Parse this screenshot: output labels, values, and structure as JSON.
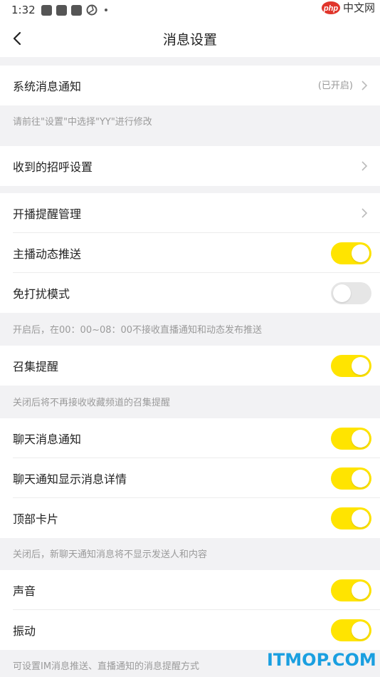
{
  "status_bar": {
    "time": "1:32"
  },
  "watermark": {
    "php": "php",
    "zhongwen": "中文网",
    "bottom": "ITMOP.COM"
  },
  "header": {
    "title": "消息设置"
  },
  "rows": {
    "system_notify": {
      "label": "系统消息通知",
      "status": "(已开启)"
    },
    "greeting": {
      "label": "收到的招呼设置"
    },
    "live_remind": {
      "label": "开播提醒管理"
    },
    "anchor_push": {
      "label": "主播动态推送",
      "on": true
    },
    "dnd_mode": {
      "label": "免打扰模式",
      "on": false
    },
    "gather_remind": {
      "label": "召集提醒",
      "on": true
    },
    "chat_notify": {
      "label": "聊天消息通知",
      "on": true
    },
    "chat_detail": {
      "label": "聊天通知显示消息详情",
      "on": true
    },
    "top_card": {
      "label": "顶部卡片",
      "on": true
    },
    "sound": {
      "label": "声音",
      "on": true
    },
    "vibrate": {
      "label": "振动",
      "on": true
    }
  },
  "notes": {
    "system": "请前往\"设置\"中选择\"YY\"进行修改",
    "dnd": "开启后，在00：00~08：00不接收直播通知和动态发布推送",
    "gather": "关闭后将不再接收收藏频道的召集提醒",
    "top_card": "关闭后，新聊天通知消息将不显示发送人和内容",
    "sound": "可设置IM消息推送、直播通知的消息提醒方式"
  },
  "colors": {
    "accent": "#ffe400",
    "background": "#f2f2f4"
  }
}
